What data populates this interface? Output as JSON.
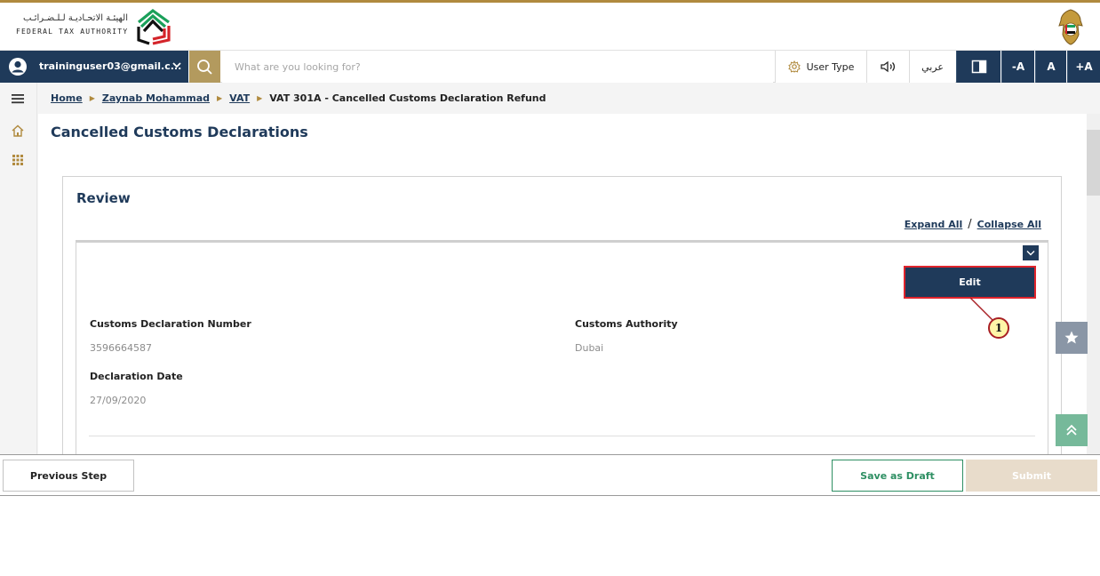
{
  "header": {
    "logo_arabic": "الهيئـة الاتحـاديـة لـلـضـرائـب",
    "logo_english": "FEDERAL TAX AUTHORITY"
  },
  "toolbar": {
    "user_email": "traininguser03@gmail.c...",
    "search_placeholder": "What are you looking for?",
    "user_type": "User Type",
    "sound_label": "◁))",
    "language": "عربي",
    "font_decrease": "-A",
    "font_reset": "A",
    "font_increase": "+A"
  },
  "breadcrumb": {
    "items": [
      "Home",
      "Zaynab Mohammad",
      "VAT"
    ],
    "current": "VAT 301A - Cancelled Customs Declaration Refund"
  },
  "page": {
    "title": "Cancelled Customs Declarations"
  },
  "review": {
    "title": "Review",
    "expand_all": "Expand All",
    "separator": "/",
    "collapse_all": "Collapse All",
    "edit_label": "Edit",
    "callout_number": "1",
    "fields": {
      "customs_declaration_number_label": "Customs Declaration Number",
      "customs_declaration_number": "3596664587",
      "customs_authority_label": "Customs Authority",
      "customs_authority": "Dubai",
      "declaration_date_label": "Declaration Date",
      "declaration_date": "27/09/2020"
    }
  },
  "footer": {
    "previous_step": "Previous Step",
    "save_as_draft": "Save as Draft",
    "submit": "Submit"
  },
  "colors": {
    "navy": "#1f3a5a",
    "gold": "#b08a3e",
    "green": "#2e8f63",
    "highlight_red": "#e0242c"
  }
}
